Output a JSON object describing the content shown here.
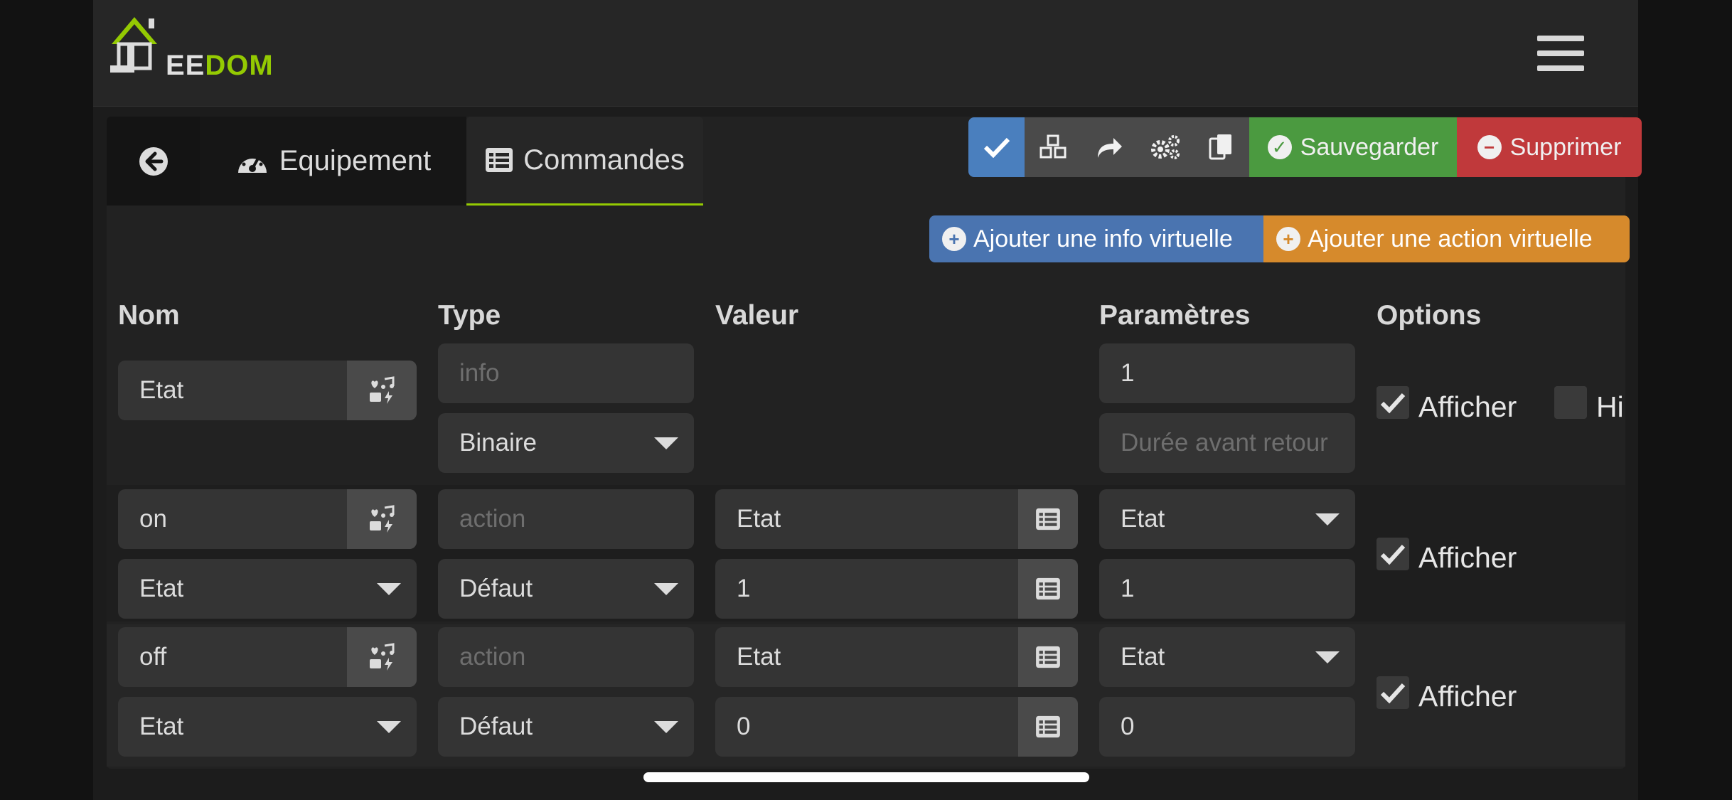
{
  "navbar": {
    "logo_text_a": "EE",
    "logo_text_b": "DOM",
    "logo_mark": "J"
  },
  "tabs": {
    "back_icon": "arrow-circle-left-icon",
    "equipement": "Equipement",
    "commandes": "Commandes"
  },
  "toolbar": {
    "save_label": "Sauvegarder",
    "delete_label": "Supprimer"
  },
  "add_buttons": {
    "info": "Ajouter une info virtuelle",
    "action": "Ajouter une action virtuelle"
  },
  "columns": {
    "nom": "Nom",
    "type": "Type",
    "valeur": "Valeur",
    "parametres": "Paramètres",
    "options": "Options"
  },
  "rows": [
    {
      "name": "Etat",
      "type_placeholder": "info",
      "subtype": "Binaire",
      "param_value": "1",
      "param_placeholder": "Durée avant retour",
      "opt_show": "Afficher",
      "opt_hist": "Hi"
    },
    {
      "name": "on",
      "type_placeholder": "action",
      "name_select": "Etat",
      "subtype": "Défaut",
      "value_1": "Etat",
      "value_2": "1",
      "param_select": "Etat",
      "param_value": "1",
      "opt_show": "Afficher"
    },
    {
      "name": "off",
      "type_placeholder": "action",
      "name_select": "Etat",
      "subtype": "Défaut",
      "value_1": "Etat",
      "value_2": "0",
      "param_select": "Etat",
      "param_value": "0",
      "opt_show": "Afficher"
    }
  ],
  "colors": {
    "accent_green": "#94ca02",
    "blue": "#4a7fbe",
    "save_green": "#4b9a40",
    "delete_red": "#c0393b",
    "orange": "#d68a2c"
  }
}
